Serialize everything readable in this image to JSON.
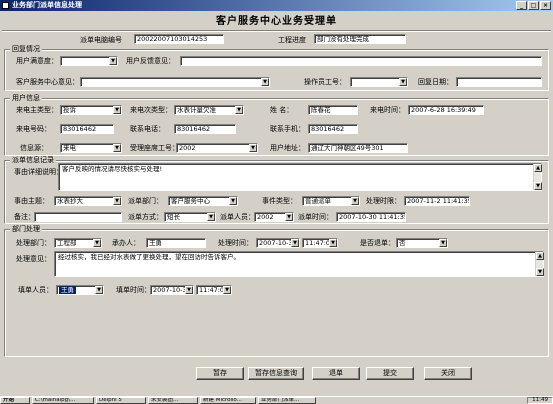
{
  "window": {
    "title": "业务部门派单信息处理",
    "min": "_",
    "max": "□",
    "close": "×"
  },
  "heading": "客户服务中心业务受理单",
  "top": {
    "order_no_label": "派单电脑编号",
    "order_no": "20022007103014253",
    "progress_label": "工程进度",
    "progress": "部门没有处理完成"
  },
  "visit": {
    "title": "回复情况",
    "satisfaction_label": "用户满意度：",
    "satisfaction": "",
    "feedback_label": "用户反馈意见：",
    "feedback": "",
    "center_opinion_label": "客户服务中心意见：",
    "center_opinion": "",
    "operator_label": "操作员工号：",
    "operator": "",
    "reply_date_label": "回复日期：",
    "reply_date": ""
  },
  "user": {
    "title": "用户信息",
    "call_main_type_label": "来电主类型：",
    "call_main_type": "投诉",
    "call_sub_type_label": "来电次类型：",
    "call_sub_type": "水表计量欠准",
    "name_label": "姓 名：",
    "name": "陈春花",
    "call_time_label": "来电时间：",
    "call_time": "2007-6-28 16:39:49",
    "phone_label": "来电号码：",
    "phone": "83016462",
    "contact_phone_label": "联系电话：",
    "contact_phone": "83016462",
    "mobile_label": "联系手机：",
    "mobile": "83016462",
    "source_label": "信息源：",
    "source": "来电",
    "receiver_label": "受理座席工号：",
    "receiver": "2002",
    "address_label": "用户地址：",
    "address": "通辽大门神朝区49号301"
  },
  "event": {
    "title": "派单信息记录",
    "desc_label": "事由详细说明：",
    "desc": "客户反映的情况请尽快核实与处理!",
    "subject_label": "事由主题：",
    "subject": "水表抄大",
    "dept_label": "派单部门：",
    "dept": "客户服务中心",
    "etype_label": "事件类型：",
    "etype": "普通派单",
    "deadline_label": "处理时限：",
    "deadline": "2007-11-2 11:41:35",
    "note_label": "备注：",
    "note": "",
    "method_label": "派单方式：",
    "method": "短长",
    "dispatcher_label": "派单人员：",
    "dispatcher": "2002",
    "dispatch_time_label": "派单时间：",
    "dispatch_time": "2007-10-30 11:41:35"
  },
  "dept": {
    "title": "部门处理",
    "proc_dept_label": "处理部门：",
    "proc_dept": "工程部",
    "handler_label": "承办人：",
    "handler": "王勇",
    "proc_time_label": "处理时间：",
    "proc_date": "2007-10-30",
    "proc_clock": "11:47:07",
    "returned_label": "是否退单：",
    "returned": "否",
    "opinion_label": "处理意见：",
    "opinion": "经过核实，我已经对水表做了更换处理，望在回访时告诉客户。",
    "filler_label": "填单人员：",
    "filler": "王勇",
    "fill_time_label": "填单时间：",
    "fill_date": "2007-10-30",
    "fill_clock": "11:47:07"
  },
  "buttons": {
    "save": "暂存",
    "draft": "暂存信息查询",
    "return": "退单",
    "submit": "提交",
    "close": "关闭"
  },
  "taskbar": {
    "start": "开始",
    "items": [
      "C:\\mainalpg\\...",
      "Delphi 5",
      "未安装图...",
      "新建 Microso...",
      "业务部门派单..."
    ],
    "clock": "11:49"
  }
}
